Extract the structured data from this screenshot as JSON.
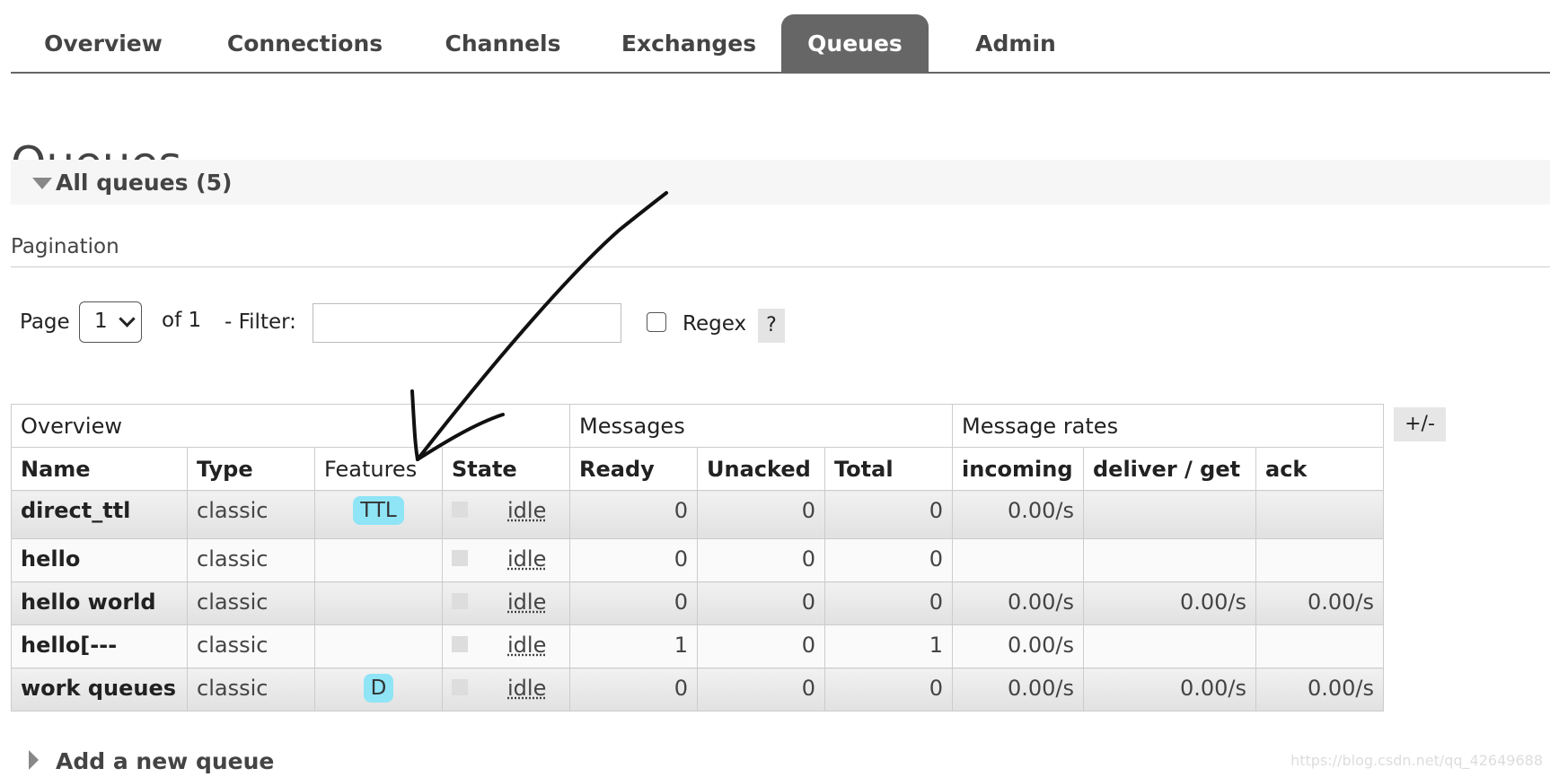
{
  "nav": {
    "tabs": [
      {
        "label": "Overview"
      },
      {
        "label": "Connections"
      },
      {
        "label": "Channels"
      },
      {
        "label": "Exchanges"
      },
      {
        "label": "Queues"
      },
      {
        "label": "Admin"
      }
    ],
    "active": "Queues"
  },
  "page_title": "Queues",
  "section": {
    "label": "All queues (5)"
  },
  "pagination": {
    "label": "Pagination",
    "page_label": "Page",
    "page_value": "1",
    "of_label": "of 1",
    "filter_label": "- Filter:",
    "filter_value": "",
    "regex_label": "Regex",
    "regex_checked": false,
    "help_label": "?"
  },
  "table": {
    "groups": [
      "Overview",
      "Messages",
      "Message rates"
    ],
    "columns": [
      "Name",
      "Type",
      "Features",
      "State",
      "Ready",
      "Unacked",
      "Total",
      "incoming",
      "deliver / get",
      "ack"
    ],
    "rows": [
      {
        "name": "direct_ttl",
        "type": "classic",
        "feature": "TTL",
        "state": "idle",
        "ready": "0",
        "unacked": "0",
        "total": "0",
        "incoming": "0.00/s",
        "deliver": "",
        "ack": ""
      },
      {
        "name": "hello",
        "type": "classic",
        "feature": "",
        "state": "idle",
        "ready": "0",
        "unacked": "0",
        "total": "0",
        "incoming": "",
        "deliver": "",
        "ack": ""
      },
      {
        "name": "hello world",
        "type": "classic",
        "feature": "",
        "state": "idle",
        "ready": "0",
        "unacked": "0",
        "total": "0",
        "incoming": "0.00/s",
        "deliver": "0.00/s",
        "ack": "0.00/s"
      },
      {
        "name": "hello[---",
        "type": "classic",
        "feature": "",
        "state": "idle",
        "ready": "1",
        "unacked": "0",
        "total": "1",
        "incoming": "0.00/s",
        "deliver": "",
        "ack": ""
      },
      {
        "name": "work queues",
        "type": "classic",
        "feature": "D",
        "state": "idle",
        "ready": "0",
        "unacked": "0",
        "total": "0",
        "incoming": "0.00/s",
        "deliver": "0.00/s",
        "ack": "0.00/s"
      }
    ],
    "columns_toggle_label": "+/-"
  },
  "add_section": {
    "label": "Add a new queue"
  },
  "watermark": "https://blog.csdn.net/qq_42649688",
  "colors": {
    "tab_active_bg": "#666666",
    "badge_bg": "#8fe4f6"
  },
  "icons": [
    "expand-triangle-icon",
    "collapse-triangle-icon",
    "chevron-down-icon",
    "annotation-arrow"
  ]
}
